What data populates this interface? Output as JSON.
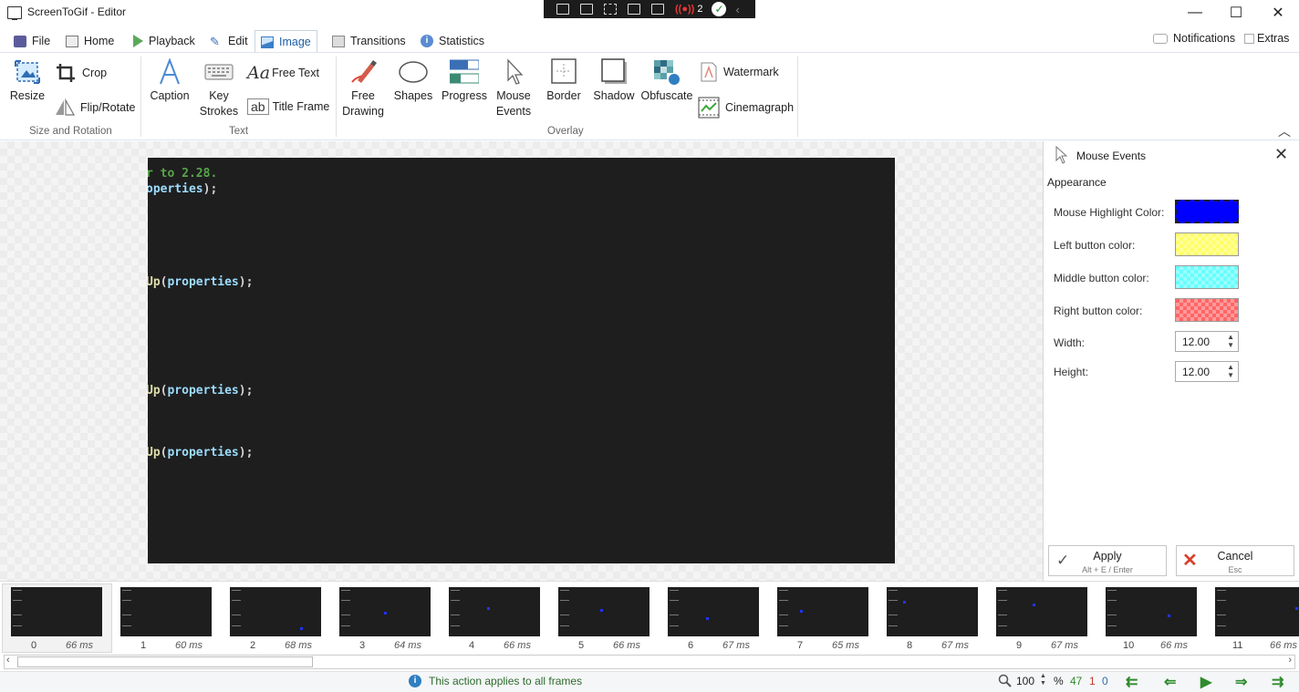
{
  "window": {
    "title": "ScreenToGif - Editor"
  },
  "recorder_bar": {
    "badge_count": "2"
  },
  "tabs": [
    {
      "label": "File"
    },
    {
      "label": "Home"
    },
    {
      "label": "Playback"
    },
    {
      "label": "Edit"
    },
    {
      "label": "Image"
    },
    {
      "label": "Transitions"
    },
    {
      "label": "Statistics"
    }
  ],
  "top_right": {
    "notifications": "Notifications",
    "extras": "Extras"
  },
  "ribbon": {
    "size_rotation": {
      "label": "Size and Rotation",
      "resize": "Resize",
      "crop": "Crop",
      "flip_rotate": "Flip/Rotate"
    },
    "text": {
      "label": "Text",
      "caption": "Caption",
      "key_strokes_1": "Key",
      "key_strokes_2": "Strokes",
      "free_text": "Free Text",
      "title_frame": "Title Frame"
    },
    "overlay": {
      "label": "Overlay",
      "free_drawing_1": "Free",
      "free_drawing_2": "Drawing",
      "shapes": "Shapes",
      "progress": "Progress",
      "mouse_events_1": "Mouse",
      "mouse_events_2": "Events",
      "border": "Border",
      "shadow": "Shadow",
      "obfuscate": "Obfuscate",
      "watermark": "Watermark",
      "cinemagraph": "Cinemagraph"
    }
  },
  "code_lines": [
    {
      "segments": [
        {
          "t": "r to 2.28.",
          "c": "g"
        }
      ]
    },
    {
      "segments": [
        {
          "t": "operties",
          "c": "b"
        },
        {
          "t": ");",
          "c": "w"
        }
      ]
    },
    {
      "segments": [
        {
          "t": "Up",
          "c": "y"
        },
        {
          "t": "(",
          "c": "w"
        },
        {
          "t": "properties",
          "c": "b"
        },
        {
          "t": ");",
          "c": "w"
        }
      ]
    },
    {
      "segments": [
        {
          "t": "Up",
          "c": "y"
        },
        {
          "t": "(",
          "c": "w"
        },
        {
          "t": "properties",
          "c": "b"
        },
        {
          "t": ");",
          "c": "w"
        }
      ]
    },
    {
      "segments": [
        {
          "t": "Up",
          "c": "y"
        },
        {
          "t": "(",
          "c": "w"
        },
        {
          "t": "properties",
          "c": "b"
        },
        {
          "t": ");",
          "c": "w"
        }
      ]
    }
  ],
  "panel": {
    "title": "Mouse Events",
    "section": "Appearance",
    "highlight_label": "Mouse Highlight Color:",
    "left_label": "Left button color:",
    "middle_label": "Middle button color:",
    "right_label": "Right button color:",
    "width_label": "Width:",
    "height_label": "Height:",
    "width_value": "12.00",
    "height_value": "12.00",
    "colors": {
      "highlight": "#0000ff",
      "left": "#ffff66",
      "middle": "#66ffff",
      "right": "#ff6666"
    },
    "apply": {
      "label": "Apply",
      "shortcut": "Alt + E / Enter"
    },
    "cancel": {
      "label": "Cancel",
      "shortcut": "Esc"
    }
  },
  "frames": [
    {
      "n": "0",
      "ms": "66 ms"
    },
    {
      "n": "1",
      "ms": "60 ms"
    },
    {
      "n": "2",
      "ms": "68 ms"
    },
    {
      "n": "3",
      "ms": "64 ms"
    },
    {
      "n": "4",
      "ms": "66 ms"
    },
    {
      "n": "5",
      "ms": "66 ms"
    },
    {
      "n": "6",
      "ms": "67 ms"
    },
    {
      "n": "7",
      "ms": "65 ms"
    },
    {
      "n": "8",
      "ms": "67 ms"
    },
    {
      "n": "9",
      "ms": "67 ms"
    },
    {
      "n": "10",
      "ms": "66 ms"
    },
    {
      "n": "11",
      "ms": "66 ms"
    }
  ],
  "status": {
    "message": "This action applies to all frames",
    "zoom": "100",
    "zoom_unit": "%",
    "total_frames": "47",
    "selected_frames": "1",
    "current_frame": "0"
  }
}
